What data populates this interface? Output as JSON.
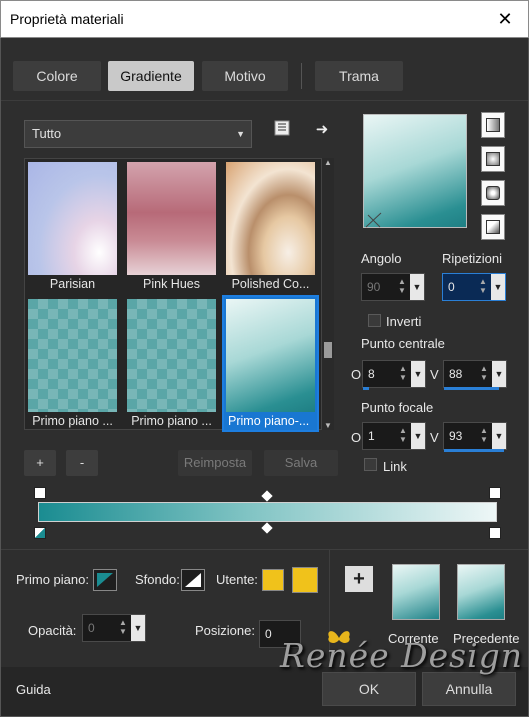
{
  "window": {
    "title": "Proprietà materiali",
    "close_glyph": "✕"
  },
  "tabs": [
    {
      "label": "Colore",
      "active": false
    },
    {
      "label": "Gradiente",
      "active": true
    },
    {
      "label": "Motivo",
      "active": false
    },
    {
      "label": "Trama",
      "active": false
    }
  ],
  "library": {
    "category": "Tutto",
    "icons": [
      "library-icon",
      "arrow-right-icon"
    ],
    "tiles": [
      {
        "label": "Parisian",
        "selected": false
      },
      {
        "label": "Pink Hues",
        "selected": false
      },
      {
        "label": "Polished Co...",
        "selected": false
      },
      {
        "label": "Primo piano ...",
        "selected": false
      },
      {
        "label": "Primo piano ...",
        "selected": false
      },
      {
        "label": "Primo piano-...",
        "selected": true
      }
    ]
  },
  "actions": {
    "add": "+",
    "remove": "-",
    "reset": "Reimposta",
    "save": "Salva"
  },
  "style_buttons": [
    "linear-style-icon",
    "rectangular-style-icon",
    "sunburst-style-icon",
    "radial-style-icon"
  ],
  "angle": {
    "label": "Angolo",
    "value": "90"
  },
  "repeats": {
    "label": "Ripetizioni",
    "value": "0"
  },
  "invert": {
    "label": "Inverti",
    "checked": false
  },
  "center_point": {
    "label": "Punto centrale",
    "o_label": "O",
    "o_value": "8",
    "v_label": "V",
    "v_value": "88"
  },
  "focal_point": {
    "label": "Punto focale",
    "o_label": "O",
    "o_value": "1",
    "v_label": "V",
    "v_value": "93"
  },
  "link": {
    "label": "Link",
    "checked": false
  },
  "colors": {
    "foreground": "#1a8c91",
    "background": "#ffffff",
    "user": "#f0c21b",
    "gradient_start": "#1a8c91",
    "gradient_end": "#eef7f7"
  },
  "bottom": {
    "foreground_label": "Primo piano:",
    "background_label": "Sfondo:",
    "user_label": "Utente:",
    "opacity_label": "Opacità:",
    "opacity_value": "0",
    "position_label": "Posizione:",
    "position_value": "0",
    "current_label": "Corrente",
    "previous_label": "Precedente"
  },
  "footer": {
    "help": "Guida",
    "ok": "OK",
    "cancel": "Annulla"
  },
  "watermark": "Renée Design"
}
